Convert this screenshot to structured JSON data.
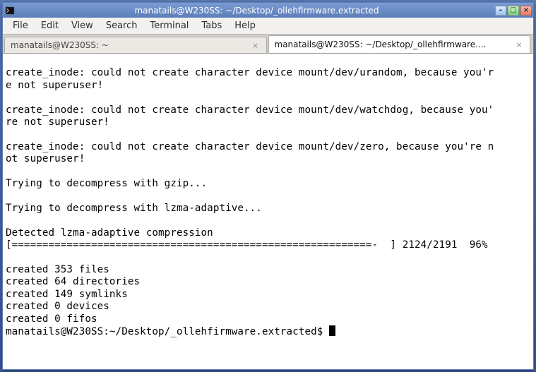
{
  "window": {
    "title": "manatails@W230SS: ~/Desktop/_ollehfirmware.extracted"
  },
  "menubar": {
    "file": "File",
    "edit": "Edit",
    "view": "View",
    "search": "Search",
    "terminal": "Terminal",
    "tabs": "Tabs",
    "help": "Help"
  },
  "tabs": [
    {
      "label": "manatails@W230SS: ~",
      "active": false
    },
    {
      "label": "manatails@W230SS: ~/Desktop/_ollehfirmware....",
      "active": true
    }
  ],
  "terminal": {
    "lines": [
      "",
      "create_inode: could not create character device mount/dev/urandom, because you'r",
      "e not superuser!",
      "",
      "create_inode: could not create character device mount/dev/watchdog, because you'",
      "re not superuser!",
      "",
      "create_inode: could not create character device mount/dev/zero, because you're n",
      "ot superuser!",
      "",
      "Trying to decompress with gzip...",
      "",
      "Trying to decompress with lzma-adaptive...",
      "",
      "Detected lzma-adaptive compression",
      "[===========================================================-  ] 2124/2191  96%",
      "",
      "created 353 files",
      "created 64 directories",
      "created 149 symlinks",
      "created 0 devices",
      "created 0 fifos"
    ],
    "prompt": "manatails@W230SS:~/Desktop/_ollehfirmware.extracted$ "
  },
  "window_buttons": {
    "min": "–",
    "max": "□",
    "close": "×"
  },
  "tab_close_glyph": "×"
}
